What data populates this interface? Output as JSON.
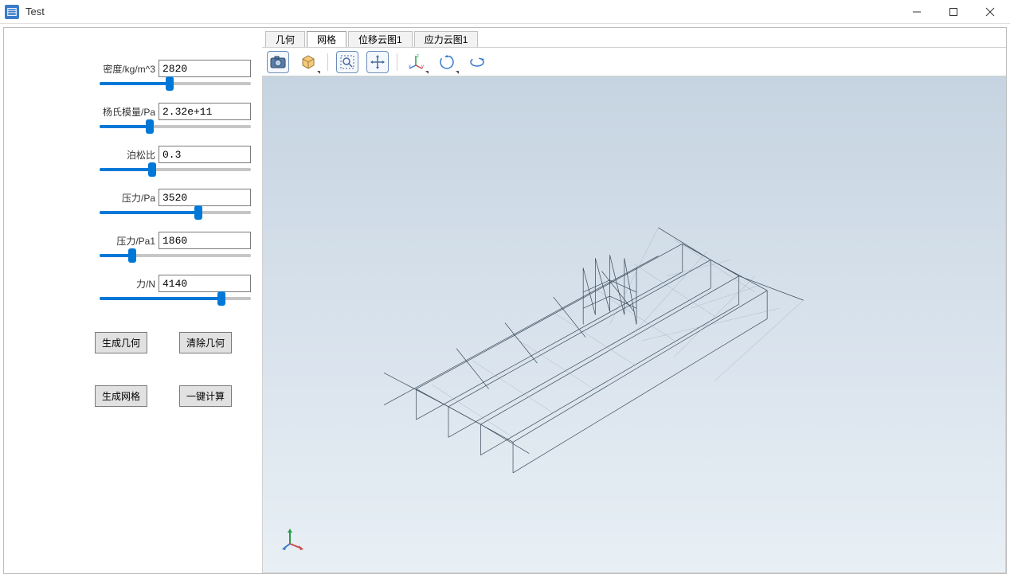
{
  "window": {
    "title": "Test"
  },
  "tabs": [
    {
      "label": "几何"
    },
    {
      "label": "网格"
    },
    {
      "label": "位移云图1"
    },
    {
      "label": "应力云图1"
    }
  ],
  "params": [
    {
      "label": "密度/kg/m^3",
      "value": "2820",
      "slider_pct": 46
    },
    {
      "label": "杨氏模量/Pa",
      "value": "2.32e+11",
      "slider_pct": 32
    },
    {
      "label": "泊松比",
      "value": "0.3",
      "slider_pct": 34
    },
    {
      "label": "压力/Pa",
      "value": "3520",
      "slider_pct": 66
    },
    {
      "label": "压力/Pa1",
      "value": "1860",
      "slider_pct": 20
    },
    {
      "label": "力/N",
      "value": "4140",
      "slider_pct": 82
    }
  ],
  "buttons": {
    "gen_geometry": "生成几何",
    "clear_geometry": "清除几何",
    "gen_mesh": "生成网格",
    "one_click_calc": "一键计算"
  },
  "toolbar_icons": {
    "camera": "camera-icon",
    "box3d": "3d-box-icon",
    "zoom_select": "zoom-rect-icon",
    "pan": "pan-arrows-icon",
    "axis_xyz": "xyz-axis-icon",
    "rotate_xy": "rotate-icon",
    "rotate_scene": "rotate-scene-icon"
  },
  "colors": {
    "accent": "#0078d7",
    "wireframe": "#3a4a5a",
    "viewer_bg_top": "#c6d4e1",
    "viewer_bg_bottom": "#e8eff5"
  }
}
